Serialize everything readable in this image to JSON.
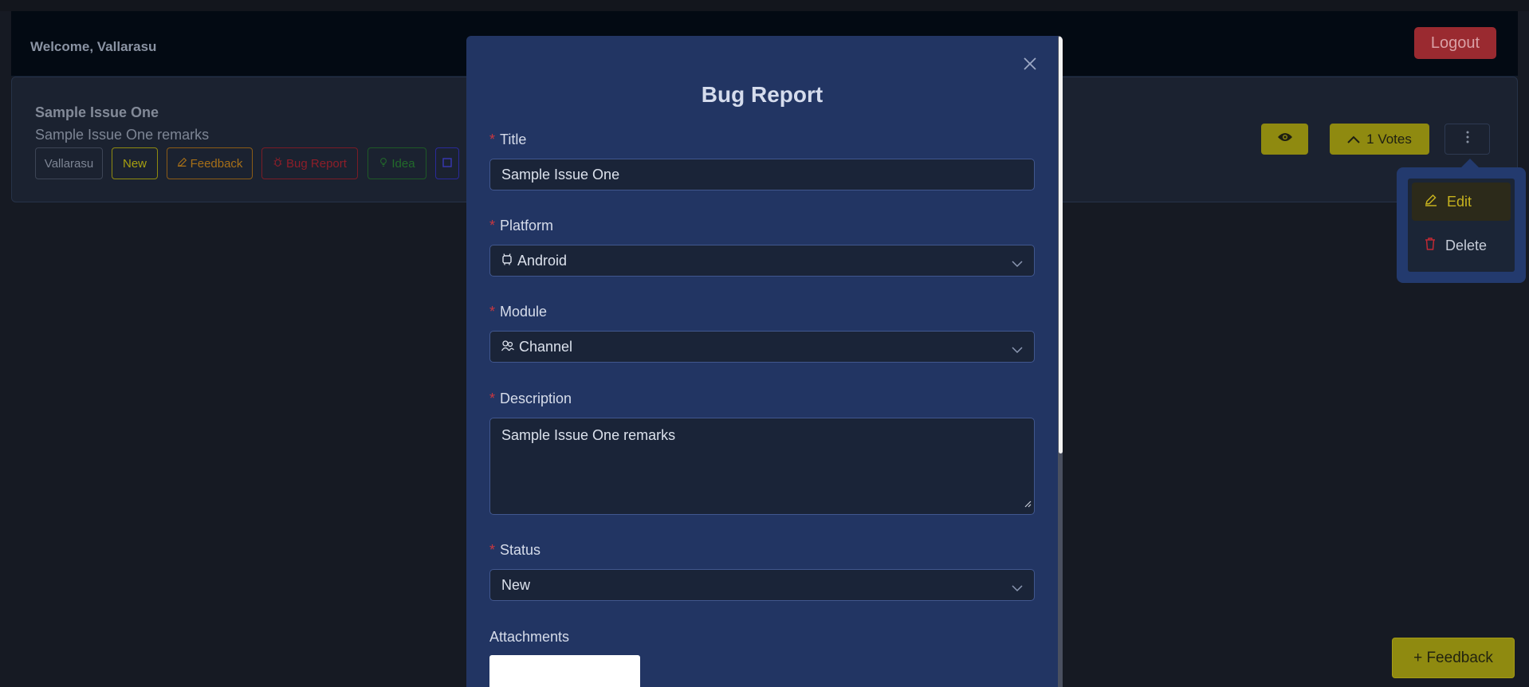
{
  "header": {
    "welcome": "Welcome, Vallarasu",
    "logout_label": "Logout"
  },
  "issue": {
    "title": "Sample Issue One",
    "remarks": "Sample Issue One remarks",
    "chips": {
      "user": "Vallarasu",
      "status": "New",
      "feedback": "Feedback",
      "bug_report": "Bug Report",
      "idea": "Idea"
    },
    "votes_label": "1 Votes"
  },
  "menu": {
    "edit": "Edit",
    "delete": "Delete"
  },
  "fab": {
    "feedback_label": "+ Feedback"
  },
  "modal": {
    "title": "Bug Report",
    "fields": {
      "title_label": "Title",
      "title_value": "Sample Issue One",
      "platform_label": "Platform",
      "platform_value": "Android",
      "module_label": "Module",
      "module_value": "Channel",
      "description_label": "Description",
      "description_value": "Sample Issue One remarks",
      "status_label": "Status",
      "status_value": "New",
      "attachments_label": "Attachments"
    },
    "required_marker": "*"
  },
  "colors": {
    "background": "#161a23",
    "modal": "#223563",
    "accent_yellow": "#8f8a10",
    "logout_red": "#9a2a30",
    "required_red": "#c9373f"
  }
}
